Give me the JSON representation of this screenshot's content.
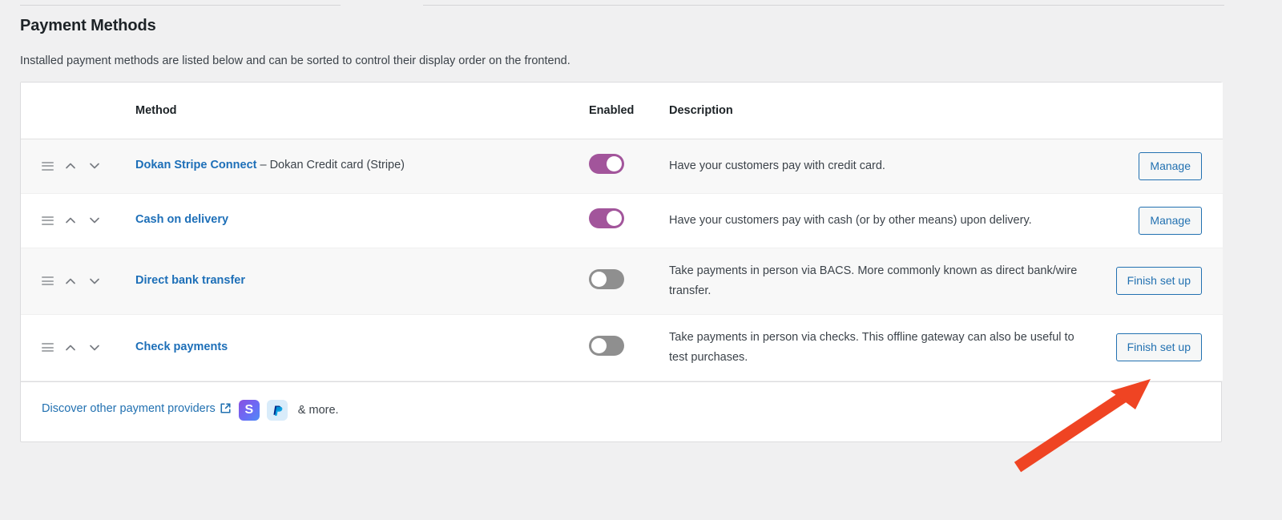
{
  "page": {
    "title": "Payment Methods",
    "subtitle": "Installed payment methods are listed below and can be sorted to control their display order on the frontend."
  },
  "colors": {
    "link_blue": "#1d6fb8",
    "button_blue": "#2271b1",
    "toggle_on": "#a2559b",
    "toggle_off": "#8f8f8f",
    "annotation_red": "#ef4423",
    "page_background": "#f0f0f1",
    "row_shaded": "#f8f8f8"
  },
  "table": {
    "headers": {
      "sort": "",
      "method": "Method",
      "enabled": "Enabled",
      "description": "Description",
      "action": ""
    },
    "rows": [
      {
        "method_name": "Dokan Stripe Connect",
        "method_suffix": " – Dokan Credit card (Stripe)",
        "enabled": true,
        "enabled_state": "on",
        "description": "Have your customers pay with credit card.",
        "action_label": "Manage",
        "shaded": true
      },
      {
        "method_name": "Cash on delivery",
        "method_suffix": "",
        "enabled": true,
        "enabled_state": "on",
        "description": "Have your customers pay with cash (or by other means) upon delivery.",
        "action_label": "Manage",
        "shaded": false
      },
      {
        "method_name": "Direct bank transfer",
        "method_suffix": "",
        "enabled": false,
        "enabled_state": "off",
        "description": "Take payments in person via BACS. More commonly known as direct bank/wire transfer.",
        "action_label": "Finish set up",
        "shaded": true
      },
      {
        "method_name": "Check payments",
        "method_suffix": "",
        "enabled": false,
        "enabled_state": "off",
        "description": "Take payments in person via checks. This offline gateway can also be useful to test purchases.",
        "action_label": "Finish set up",
        "shaded": false
      }
    ]
  },
  "footer": {
    "discover_label": "Discover other payment providers",
    "external_link_icon": "external-link-icon",
    "providers": [
      {
        "name": "stripe-icon",
        "glyph": "S"
      },
      {
        "name": "paypal-icon",
        "glyph": "P"
      }
    ],
    "more_text": "& more."
  },
  "annotation": {
    "type": "arrow",
    "color": "#ef4423",
    "points_to": "Finish set up"
  }
}
